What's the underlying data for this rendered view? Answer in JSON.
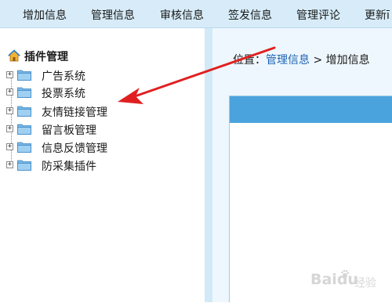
{
  "top_menu": {
    "items": [
      "增加信息",
      "管理信息",
      "审核信息",
      "签发信息",
      "管理评论",
      "更新ī"
    ]
  },
  "tree": {
    "title": "插件管理",
    "nodes": [
      "广告系统",
      "投票系统",
      "友情链接管理",
      "留言板管理",
      "信息反馈管理",
      "防采集插件"
    ]
  },
  "breadcrumb": {
    "prefix": "位置：",
    "link": "管理信息",
    "separator": " > ",
    "current": "增加信息"
  },
  "watermark": {
    "text": "Baidu",
    "sub": "经验"
  },
  "colors": {
    "topbar": "#d7ecf8",
    "panel_header": "#4ba3dd",
    "arrow": "#e02020",
    "link": "#1d63b5"
  },
  "icons": [
    "home-icon",
    "folder-icon",
    "expand-plus-icon",
    "arrow-annotation"
  ]
}
